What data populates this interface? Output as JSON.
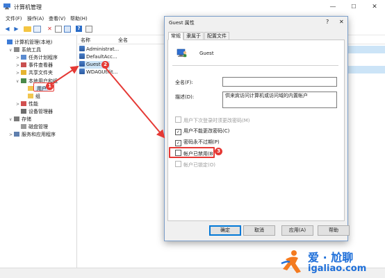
{
  "window": {
    "title": "计算机管理",
    "minimize": "—",
    "maximize": "☐",
    "close": "✕"
  },
  "menubar": [
    "文件(F)",
    "操作(A)",
    "查看(V)",
    "帮助(H)"
  ],
  "toolbar": [
    "back-icon",
    "forward-icon",
    "folder-up-icon",
    "show-tree-icon",
    "delete-icon",
    "properties-icon",
    "export-icon",
    "help-icon",
    "view-icon"
  ],
  "tree": [
    {
      "label": "计算机管理(本地)",
      "indent": 0,
      "expander": "",
      "icon": "computer-icon"
    },
    {
      "label": "系统工具",
      "indent": 1,
      "expander": "∨",
      "icon": "tools-icon"
    },
    {
      "label": "任务计划程序",
      "indent": 2,
      "expander": ">",
      "icon": "task-scheduler-icon"
    },
    {
      "label": "事件查看器",
      "indent": 2,
      "expander": ">",
      "icon": "event-viewer-icon"
    },
    {
      "label": "共享文件夹",
      "indent": 2,
      "expander": ">",
      "icon": "shared-folder-icon"
    },
    {
      "label": "本地用户和组",
      "indent": 2,
      "expander": "∨",
      "icon": "users-groups-icon"
    },
    {
      "label": "用户",
      "indent": 3,
      "expander": "",
      "icon": "folder-icon",
      "selected": true
    },
    {
      "label": "组",
      "indent": 3,
      "expander": "",
      "icon": "folder-icon"
    },
    {
      "label": "性能",
      "indent": 2,
      "expander": ">",
      "icon": "performance-icon"
    },
    {
      "label": "设备管理器",
      "indent": 2,
      "expander": "",
      "icon": "device-manager-icon"
    },
    {
      "label": "存储",
      "indent": 1,
      "expander": "∨",
      "icon": "storage-icon"
    },
    {
      "label": "磁盘管理",
      "indent": 2,
      "expander": "",
      "icon": "disk-icon"
    },
    {
      "label": "服务和应用程序",
      "indent": 1,
      "expander": ">",
      "icon": "services-icon"
    }
  ],
  "list": {
    "headers": [
      "名称",
      "全名"
    ],
    "rows": [
      "Administrat...",
      "DefaultAcc...",
      "Guest",
      "WDAGUtilit..."
    ]
  },
  "dialog": {
    "title": "Guest 属性",
    "help": "?",
    "close": "✕",
    "tabs": [
      "常规",
      "隶属于",
      "配置文件"
    ],
    "username": "Guest",
    "fullname_label": "全名(F):",
    "fullname_value": "",
    "desc_label": "描述(D):",
    "desc_value": "供来宾访问计算机或访问域的内置帐户",
    "checkboxes": [
      {
        "label": "用户下次登录时须更改密码(M)",
        "checked": false,
        "disabled": true
      },
      {
        "label": "用户不能更改密码(C)",
        "checked": true,
        "disabled": false
      },
      {
        "label": "密码永不过期(P)",
        "checked": true,
        "disabled": false
      },
      {
        "label": "帐户已禁用(B)",
        "checked": false,
        "disabled": false
      },
      {
        "label": "帐户已锁定(O)",
        "checked": false,
        "disabled": true
      }
    ],
    "buttons": {
      "ok": "确定",
      "cancel": "取消",
      "apply": "应用(A)",
      "help": "帮助"
    }
  },
  "annotations": [
    "1",
    "2",
    "3"
  ],
  "watermark": {
    "brand_cn": "爱 · 尬聊",
    "brand_url": "igaliao.com"
  },
  "colors": {
    "accent": "#0078d7",
    "annotation": "#e53935",
    "selection": "#cce4f7"
  }
}
